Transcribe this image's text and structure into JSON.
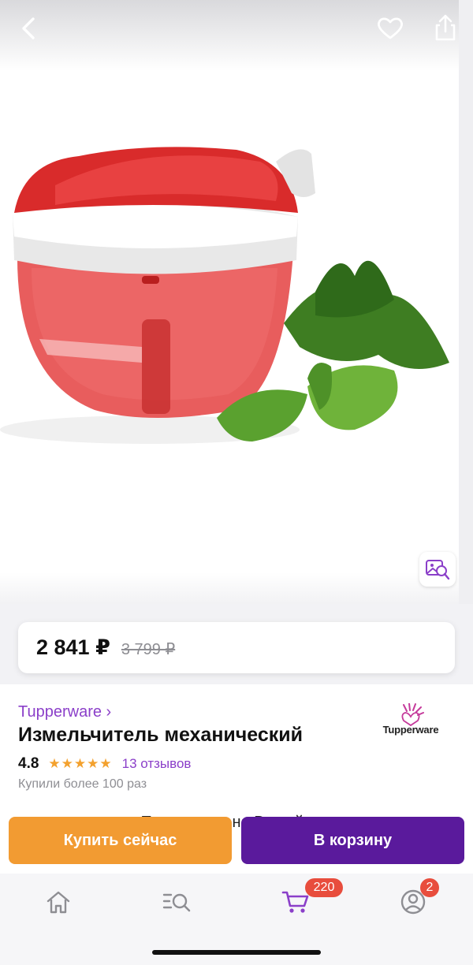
{
  "header": {
    "back_icon": "chevron-left-icon",
    "favorite_icon": "heart-icon",
    "share_icon": "share-icon"
  },
  "gallery": {
    "visual_search_icon": "image-search-icon"
  },
  "price": {
    "current": "2 841 ₽",
    "old": "3 799 ₽"
  },
  "product": {
    "brand_link": "Tupperware ›",
    "title": "Измельчитель механический",
    "rating": "4.8",
    "stars": "★★★★★",
    "reviews": "13 отзывов",
    "bought": "Купили более 100 раз",
    "brand_logo_text": "Tupperware",
    "description_partial": "слезы навсегда. Поместится на Вашей ладони,"
  },
  "actions": {
    "buy_now": "Купить сейчас",
    "add_to_cart": "В корзину"
  },
  "tabbar": {
    "items": [
      {
        "icon": "home-icon"
      },
      {
        "icon": "catalog-search-icon"
      },
      {
        "icon": "cart-icon",
        "badge": "220"
      },
      {
        "icon": "profile-icon",
        "badge": "2"
      }
    ]
  },
  "colors": {
    "accent_purple": "#8b3fc9",
    "cart_button": "#5a1a9c",
    "buy_button": "#f29b32",
    "badge": "#e84d3d",
    "stars": "#f3a12e"
  }
}
